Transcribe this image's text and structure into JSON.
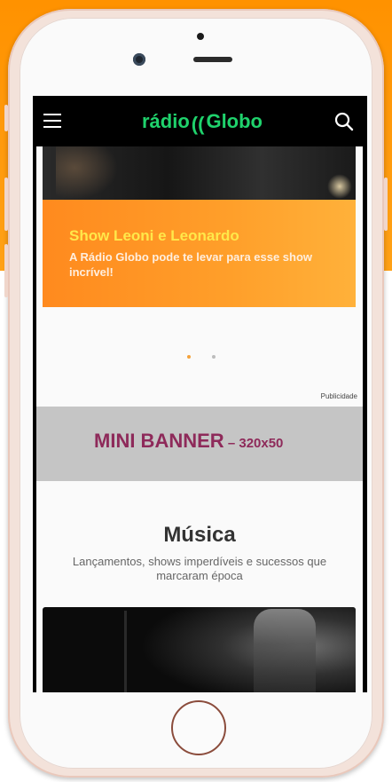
{
  "app": {
    "logo_prefix": "rádio",
    "logo_waves": "((",
    "logo_suffix": "Globo",
    "brand_green": "#1fd26c",
    "background_orange": "#ff9200"
  },
  "topbar": {
    "menu_icon": "hamburger-icon",
    "search_icon": "search-icon"
  },
  "carousel": {
    "title": "Show Leoni e Leonardo",
    "description": "A Rádio Globo pode te levar para esse show incrível!",
    "title_color": "#ffe84a",
    "dots": [
      {
        "active": true,
        "color": "#f4a23a"
      },
      {
        "active": false,
        "color": "#bcbcbc"
      }
    ]
  },
  "ad": {
    "label": "Publicidade",
    "banner_main": "MINI BANNER",
    "banner_size": " – 320x50",
    "banner_color": "#8e2a5a"
  },
  "section": {
    "title": "Música",
    "subtitle": "Lançamentos, shows imperdíveis e sucessos que marcaram época"
  }
}
